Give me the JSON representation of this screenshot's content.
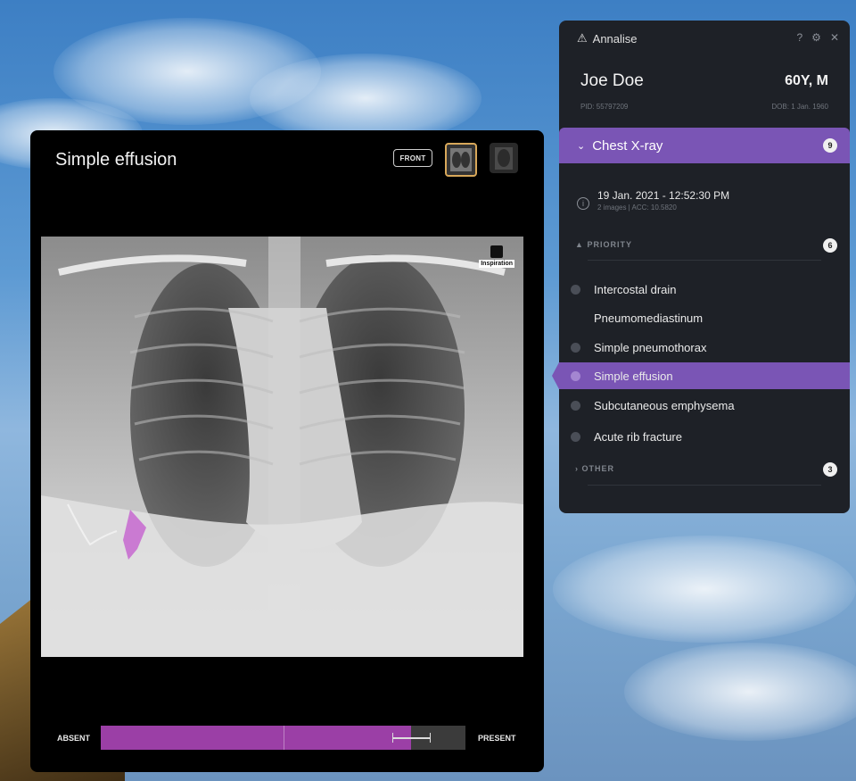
{
  "viewer": {
    "title": "Simple effusion",
    "view_label": "FRONT",
    "annotation_label": "Inspiration",
    "scale": {
      "absent_label": "ABSENT",
      "present_label": "PRESENT",
      "confidence": 0.85,
      "fill_color": "#9b3fa6"
    }
  },
  "panel": {
    "app_name": "Annalise",
    "patient": {
      "name": "Joe Doe",
      "age_sex": "60Y, M",
      "pid": "PID: 55797209",
      "dob": "DOB: 1 Jan. 1960"
    },
    "study": {
      "label": "Chest X-ray",
      "count": "9",
      "date": "19 Jan. 2021 - 12:52:30 PM",
      "meta": "2 images | ACC: 10.5820"
    },
    "priority": {
      "label": "PRIORITY",
      "count": "6",
      "findings": [
        {
          "label": "Intercostal drain"
        },
        {
          "label": "Pneumomediastinum"
        },
        {
          "label": "Simple pneumothorax"
        },
        {
          "label": "Simple effusion"
        },
        {
          "label": "Subcutaneous emphysema"
        },
        {
          "label": "Acute rib fracture"
        }
      ]
    },
    "other": {
      "label": "OTHER",
      "count": "3"
    }
  },
  "colors": {
    "accent": "#7a55b5",
    "panel_bg": "#1e2127",
    "segmentation": "#c86fd0"
  }
}
